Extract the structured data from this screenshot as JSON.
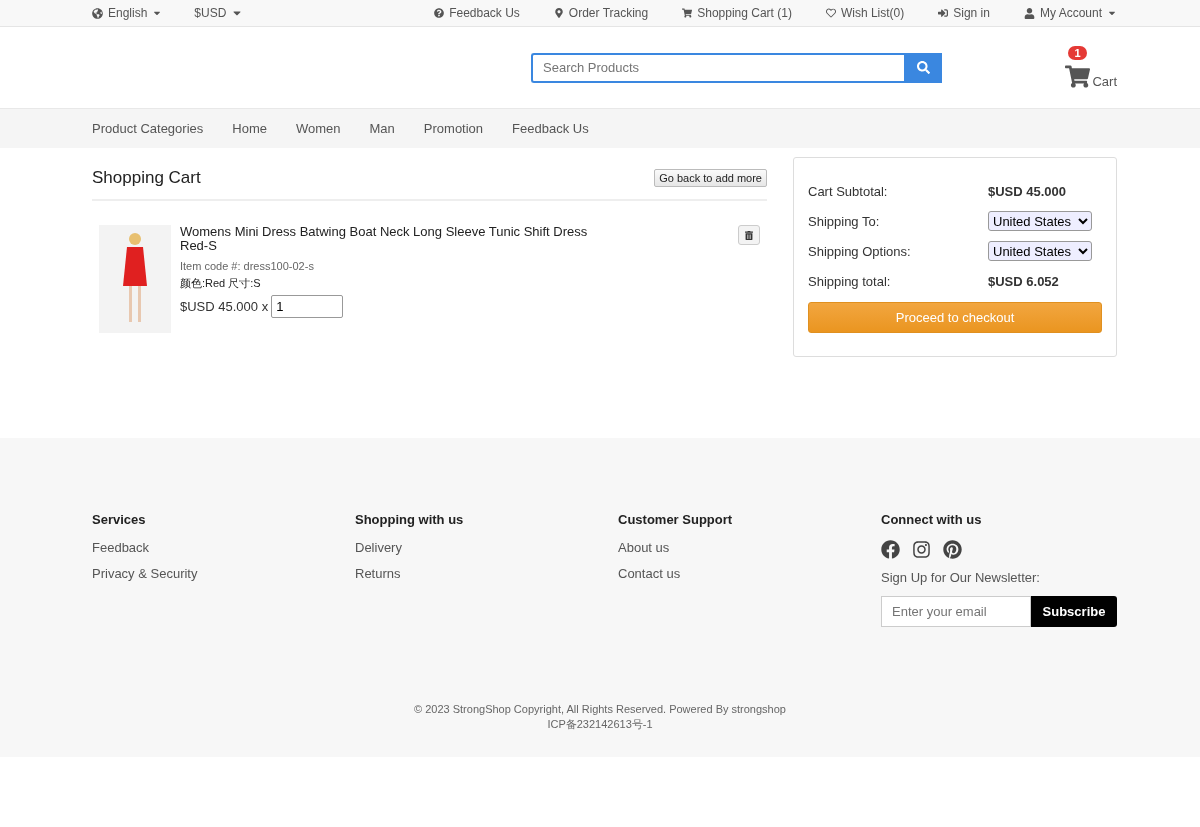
{
  "top_bar": {
    "language": "English",
    "currency": "$USD",
    "links": [
      {
        "kind": "feedback",
        "label": "Feedback Us"
      },
      {
        "kind": "tracking",
        "label": "Order Tracking"
      },
      {
        "kind": "cart",
        "label": "Shopping Cart (1)"
      },
      {
        "kind": "wishlist",
        "label": "Wish List(0)"
      },
      {
        "kind": "signin",
        "label": "Sign in"
      }
    ],
    "account": "My Account"
  },
  "header": {
    "search": {
      "placeholder": "Search Products"
    },
    "cart": {
      "count": "1",
      "label": "Cart"
    }
  },
  "nav": [
    "Product Categories",
    "Home",
    "Women",
    "Man",
    "Promotion",
    "Feedback Us"
  ],
  "cart": {
    "title": "Shopping Cart",
    "back_button": "Go back to add more",
    "items": [
      {
        "name": "Womens Mini Dress Batwing Boat Neck Long Sleeve Tunic Shift Dress Red-S",
        "code": "Item code #: dress100-02-s",
        "options": "颜色:Red 尺寸:S",
        "price": "$USD 45.000 x",
        "quantity": "1"
      }
    ]
  },
  "summary": {
    "rows": [
      {
        "kind": "text",
        "label": "Cart Subtotal:",
        "value": "$USD 45.000"
      },
      {
        "kind": "select",
        "label": "Shipping To:",
        "value": "United States"
      },
      {
        "kind": "select",
        "label": "Shipping Options:",
        "value": "United States"
      },
      {
        "kind": "text",
        "label": "Shipping total:",
        "value": "$USD 6.052"
      }
    ],
    "checkout": "Proceed to checkout"
  },
  "footer": {
    "columns": [
      {
        "title": "Services",
        "links": [
          "Feedback",
          "Privacy & Security"
        ]
      },
      {
        "title": "Shopping with us",
        "links": [
          "Delivery",
          "Returns"
        ]
      },
      {
        "title": "Customer Support",
        "links": [
          "About us",
          "Contact us"
        ]
      }
    ],
    "connect": {
      "title": "Connect with us",
      "newsletter_label": "Sign Up for Our Newsletter:",
      "email": {
        "placeholder": "Enter your email"
      },
      "subscribe": "Subscribe"
    },
    "copyright": "© 2023 StrongShop Copyright, All Rights Reserved. Powered By strongshop",
    "icp": "ICP备232142613号-1"
  }
}
